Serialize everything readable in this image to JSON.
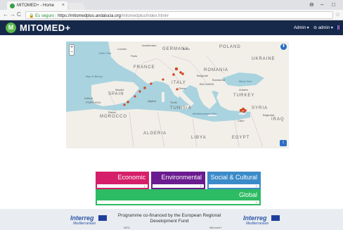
{
  "browser": {
    "tab_title": "MITOMED+ - Home",
    "tab_close": "×",
    "secure_label": "Es seguro",
    "url_host": "https://mitomedplus.andalucia.org",
    "url_path": "/mitomedplus/index.html#",
    "window_min": "–",
    "window_max": "□"
  },
  "app": {
    "logo_letter": "M",
    "name": "MITOMED+",
    "menu_admin": "Admin ▾",
    "menu_user": "admin ▾"
  },
  "map": {
    "zoom_in": "+",
    "zoom_out": "−",
    "labels": {
      "poland": "POLAND",
      "germany": "GERMANY",
      "london": "London",
      "amsterdam": "Amsterdam",
      "berlin": "Berlin",
      "celtic_sea": "Celtic Sea",
      "paris": "Paris",
      "ukraine": "UKRAINE",
      "france": "FRANCE",
      "romania": "ROMANIA",
      "bay_of_biscay": "Bay of Biscay",
      "italy": "ITALY",
      "belgrade": "Belgrade",
      "bucharest": "Bucharest",
      "black_sea": "Black Sea",
      "portugal": "PORTUGAL",
      "spain": "SPAIN",
      "madrid": "Madrid",
      "rome": "Rome",
      "bulgaria": "BULGARIA",
      "ankara": "Ankara",
      "lisbon": "Lisbon",
      "turkey": "TURKEY",
      "algiers": "Algiers",
      "tunis": "Tunis",
      "rabat": "Rabat",
      "morocco": "MOROCCO",
      "tunisia": "TUNISIA",
      "syria": "SYRIA",
      "mediterranean_sea": "Mediterranean Sea",
      "iraq": "IRAQ",
      "baghdad": "Baghdad",
      "cairo": "Cairo",
      "algeria": "ALGERIA",
      "libya": "LIBYA",
      "egypt": "EGYPT"
    },
    "compass": "⬆",
    "info": "i"
  },
  "categories": {
    "economic": "Economic",
    "environmental": "Environmental",
    "social": "Social & Cultural",
    "global": "Global",
    "info_icon": "i",
    "colors": {
      "economic": "#d61f6a",
      "environmental": "#6a1b8f",
      "social": "#3b8bc9",
      "global": "#2dbb63"
    }
  },
  "footer": {
    "text": "Programme co-financed by the European Regional Development Fund",
    "logo_name": "Interreg",
    "logo_sub": "Mediterranean",
    "left_small": "MED",
    "right_small": "Mitomed+"
  }
}
